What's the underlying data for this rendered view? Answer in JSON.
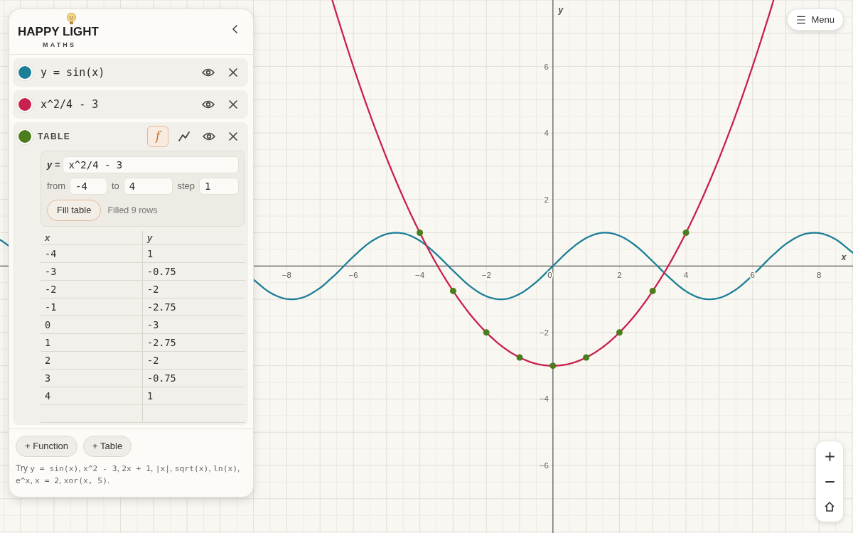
{
  "panel": {
    "logo": {
      "title": "HAPPY LIGHT",
      "subtitle": "MATHS"
    },
    "expressions": [
      {
        "kind": "function",
        "color": "#1b7f97",
        "text": "y = sin(x)",
        "visible": true
      },
      {
        "kind": "function",
        "color": "#c8204f",
        "text": "x^2/4 - 3",
        "visible": true
      },
      {
        "kind": "table",
        "color": "#4b7d1c",
        "title": "TABLE",
        "visible": true,
        "modes": [
          {
            "kind": "formula",
            "label": "f",
            "selected": true
          },
          {
            "kind": "graph",
            "selected": false
          }
        ],
        "generator": {
          "y_label": "y =",
          "formula": "x^2/4 - 3",
          "from_label": "from",
          "from": "-4",
          "to_label": "to",
          "to": "4",
          "step_label": "step",
          "step": "1",
          "button": "Fill table",
          "status": "Filled 9 rows"
        },
        "columns": [
          "x",
          "y"
        ],
        "rows": [
          [
            "-4",
            "1"
          ],
          [
            "-3",
            "-0.75"
          ],
          [
            "-2",
            "-2"
          ],
          [
            "-1",
            "-2.75"
          ],
          [
            "0",
            "-3"
          ],
          [
            "1",
            "-2.75"
          ],
          [
            "2",
            "-2"
          ],
          [
            "3",
            "-0.75"
          ],
          [
            "4",
            "1"
          ]
        ]
      }
    ],
    "add_buttons": [
      "+ Function",
      "+ Table"
    ],
    "hint": [
      {
        "kind": "text",
        "text": "Try "
      },
      {
        "kind": "code",
        "text": "y = sin(x)"
      },
      {
        "kind": "text",
        "text": ", "
      },
      {
        "kind": "code",
        "text": "x^2 - 3"
      },
      {
        "kind": "text",
        "text": ", "
      },
      {
        "kind": "code",
        "text": "2x + 1"
      },
      {
        "kind": "text",
        "text": ", "
      },
      {
        "kind": "code",
        "text": "|x|"
      },
      {
        "kind": "text",
        "text": ", "
      },
      {
        "kind": "code",
        "text": "sqrt(x)"
      },
      {
        "kind": "text",
        "text": ", "
      },
      {
        "kind": "code",
        "text": "ln(x)"
      },
      {
        "kind": "text",
        "text": ", "
      },
      {
        "kind": "code",
        "text": "e^x"
      },
      {
        "kind": "text",
        "text": ", "
      },
      {
        "kind": "code",
        "text": "x = 2"
      },
      {
        "kind": "text",
        "text": ", "
      },
      {
        "kind": "code",
        "text": "xor(x, 5)"
      },
      {
        "kind": "text",
        "text": "."
      }
    ]
  },
  "graph": {
    "chart_data": {
      "type": "line",
      "xlabel": "x",
      "ylabel": "y",
      "grid": true,
      "xlim": [
        -16.62,
        9.02
      ],
      "ylim": [
        -8.03,
        8.0
      ],
      "xticks": [
        {
          "value": -8,
          "label": "−8"
        },
        {
          "value": -6,
          "label": "−6"
        },
        {
          "value": -4,
          "label": "−4"
        },
        {
          "value": -2,
          "label": "−2"
        },
        0,
        2,
        4,
        6,
        8
      ],
      "yticks": [
        {
          "value": -6,
          "label": "−6"
        },
        {
          "value": -4,
          "label": "−4"
        },
        {
          "value": -2,
          "label": "−2"
        },
        2,
        4,
        6
      ],
      "x": [
        -16.62,
        -16.5,
        -16.36,
        -16,
        -15.5,
        -15,
        -14.5,
        -14,
        -13.5,
        -13,
        -12.5,
        -12,
        -11.5,
        -11,
        -10.5,
        -10,
        -9.5,
        -9,
        -8.5,
        -8,
        -7.5,
        -7,
        -6.63,
        -6.5,
        -6,
        -5.5,
        -5,
        -4.5,
        -4,
        -3.5,
        -3,
        -2.5,
        -2,
        -1.5,
        -1,
        -0.5,
        0,
        0.5,
        1,
        1.5,
        2,
        2.5,
        3,
        3.5,
        4,
        4.5,
        5,
        5.5,
        6,
        6.5,
        6.63,
        7,
        7.5,
        8,
        8.5,
        9,
        9.02
      ],
      "series": [
        {
          "color": "#1b7f97",
          "values": [
            0.79,
            0.71,
            0.61,
            null,
            null,
            null,
            null,
            null,
            null,
            null,
            null,
            null,
            null,
            null,
            null,
            null,
            null,
            -0.41,
            -0.8,
            -0.99,
            -0.94,
            -0.66,
            -0.34,
            -0.22,
            0.28,
            0.71,
            0.96,
            0.98,
            0.76,
            0.35,
            -0.14,
            -0.6,
            -0.91,
            -1,
            -0.84,
            -0.48,
            0,
            0.48,
            0.84,
            1,
            0.91,
            0.6,
            0.14,
            -0.35,
            -0.76,
            -0.98,
            -0.96,
            -0.71,
            -0.28,
            0.22,
            0.34,
            0.66,
            0.94,
            0.99,
            0.8,
            0.41,
            0.39
          ]
        },
        {
          "color": "#c8204f",
          "values": [
            null,
            null,
            null,
            null,
            null,
            null,
            null,
            null,
            null,
            null,
            null,
            null,
            null,
            null,
            null,
            null,
            null,
            null,
            null,
            null,
            null,
            null,
            7.99,
            7.56,
            6,
            4.56,
            3.25,
            2.06,
            1,
            0.06,
            -0.75,
            -1.44,
            -2,
            -2.44,
            -2.75,
            -2.94,
            -3,
            -2.94,
            -2.75,
            -2.44,
            -2,
            -1.44,
            -0.75,
            0.06,
            1,
            2.06,
            3.25,
            4.56,
            6,
            7.56,
            7.99,
            null,
            null,
            null,
            null,
            null,
            null
          ]
        }
      ]
    },
    "table_points": {
      "chart_data": {
        "type": "scatter",
        "xlim": [
          -16.62,
          9.02
        ],
        "ylim": [
          -8.03,
          8.0
        ],
        "x": [
          -4,
          -3,
          -2,
          -1,
          0,
          1,
          2,
          3,
          4
        ],
        "series": [
          {
            "color": "#4b7d1c",
            "values": [
              1,
              -0.75,
              -2,
              -2.75,
              -3,
              -2.75,
              -2,
              -0.75,
              1
            ]
          }
        ]
      }
    }
  },
  "menu_button": "Menu"
}
